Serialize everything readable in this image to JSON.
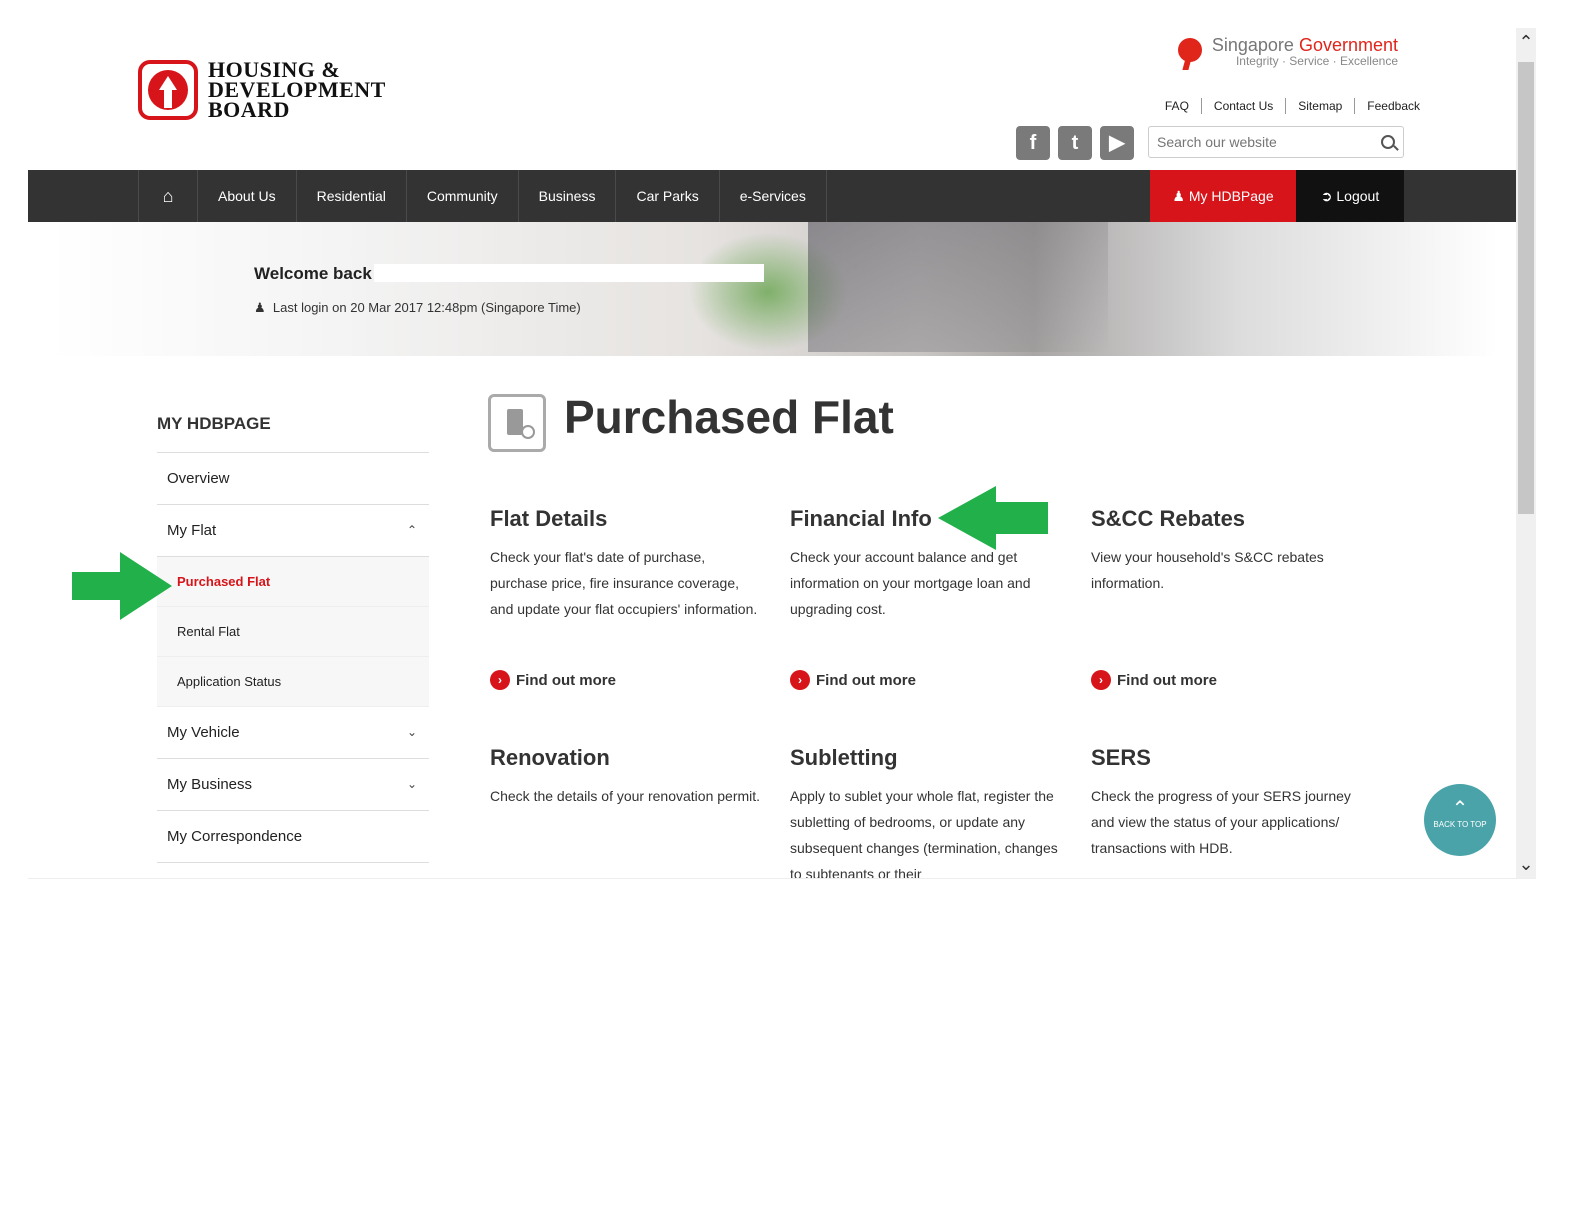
{
  "header": {
    "logo_line1": "HOUSING &",
    "logo_line2": "DEVELOPMENT",
    "logo_line3": "BOARD",
    "sgov_name_a": "Singapore",
    "sgov_name_b": "Government",
    "sgov_tagline": "Integrity · Service · Excellence",
    "toplinks": [
      "FAQ",
      "Contact Us",
      "Sitemap",
      "Feedback"
    ],
    "social": [
      "facebook-icon",
      "twitter-icon",
      "youtube-icon"
    ],
    "search_placeholder": "Search our website"
  },
  "nav": {
    "items": [
      "About Us",
      "Residential",
      "Community",
      "Business",
      "Car Parks",
      "e-Services"
    ],
    "myhdb": "My HDBPage",
    "logout": "Logout"
  },
  "banner": {
    "welcome": "Welcome back",
    "lastlogin": "Last login on 20 Mar 2017 12:48pm (Singapore Time)"
  },
  "sidebar": {
    "title": "MY HDBPAGE",
    "overview": "Overview",
    "my_flat": "My Flat",
    "sub": [
      "Purchased Flat",
      "Rental Flat",
      "Application Status"
    ],
    "my_vehicle": "My Vehicle",
    "my_business": "My Business",
    "my_correspondence": "My Correspondence"
  },
  "main": {
    "title": "Purchased Flat",
    "more_label": "Find out more",
    "cards": [
      {
        "title": "Flat Details",
        "desc": "Check your flat's date of purchase, purchase price, fire insurance coverage, and update your flat occupiers' information."
      },
      {
        "title": "Financial Info",
        "desc": "Check your account balance and get information on your mortgage loan and upgrading cost."
      },
      {
        "title": "S&CC Rebates",
        "desc": "View your household's S&CC rebates information."
      },
      {
        "title": "Renovation",
        "desc": "Check the details of your renovation permit."
      },
      {
        "title": "Subletting",
        "desc": "Apply to sublet your whole flat, register the subletting of bedrooms, or update any subsequent changes (termination, changes to subtenants or their"
      },
      {
        "title": "SERS",
        "desc": "Check the progress of your SERS journey and view the status of your applications/ transactions with HDB."
      }
    ]
  },
  "backtotop": "BACK TO TOP",
  "colors": {
    "brand_red": "#d7141a",
    "nav_bg": "#333333",
    "arrow_green": "#22b04b",
    "backtotop": "#4aa3a8"
  }
}
